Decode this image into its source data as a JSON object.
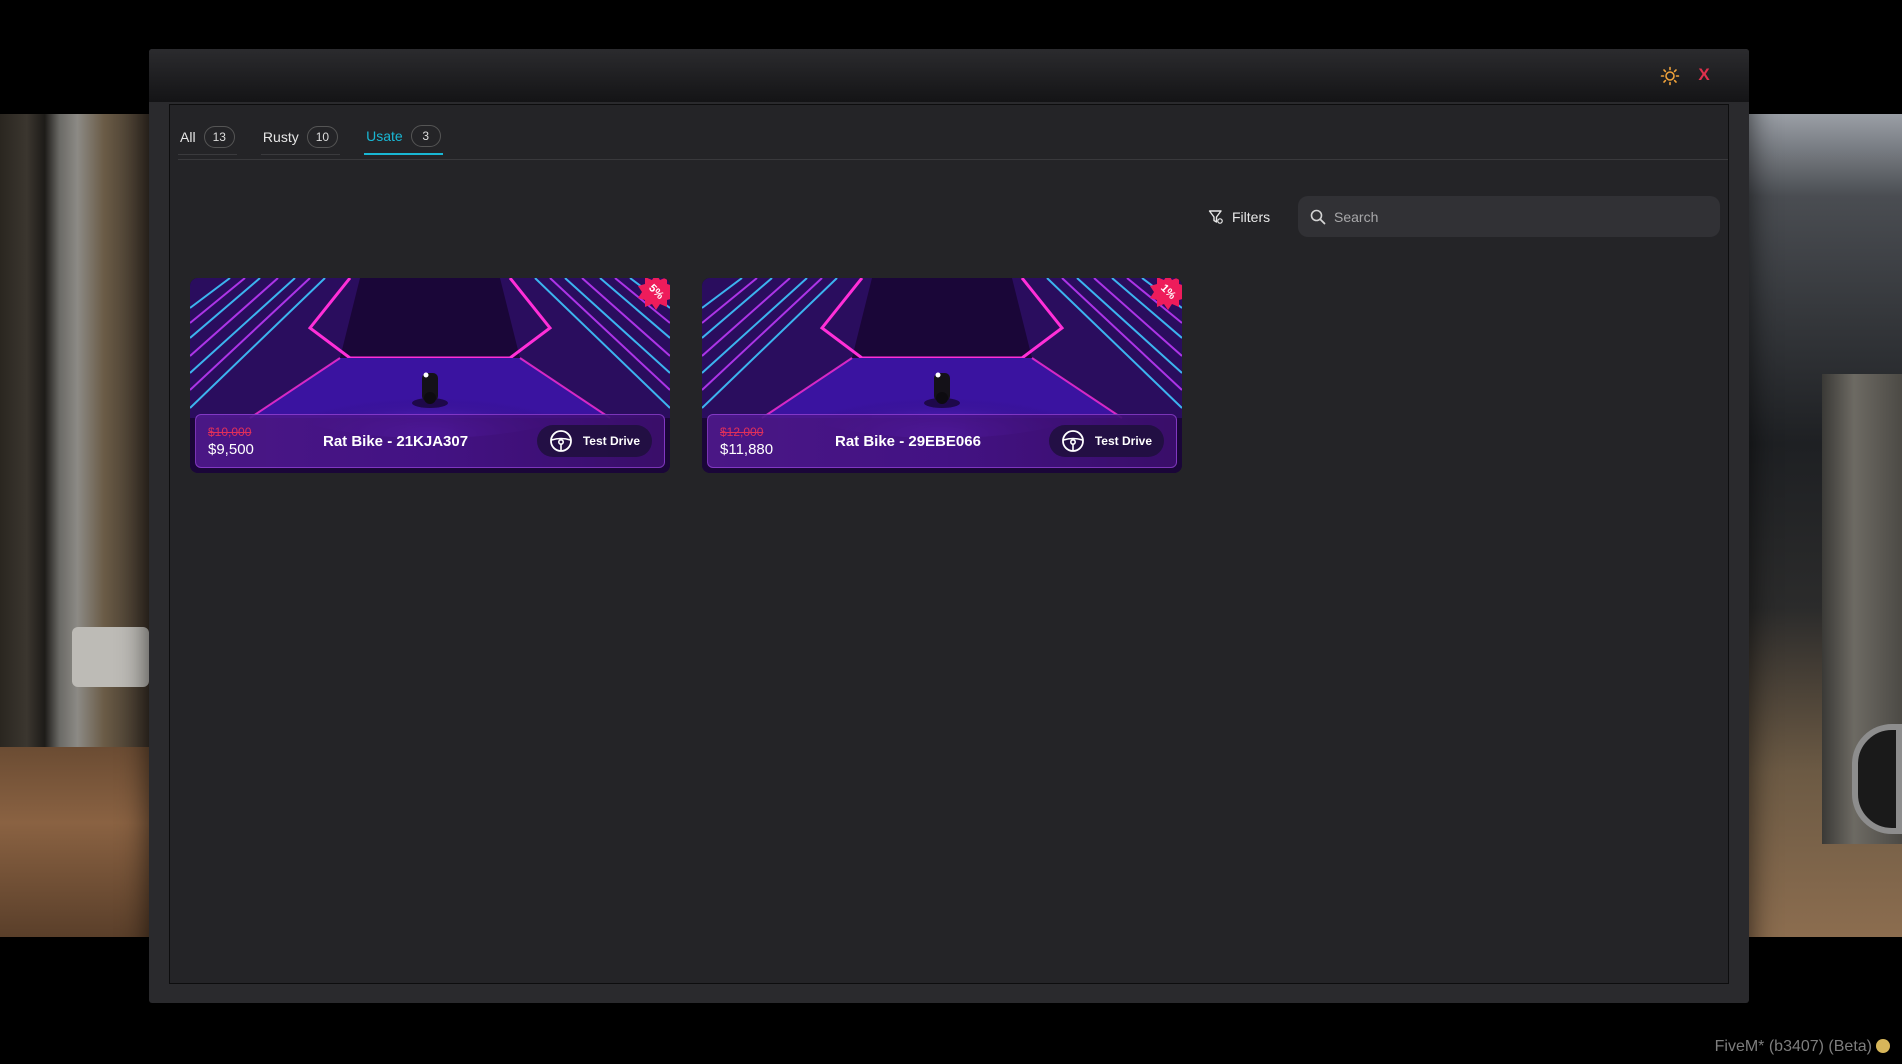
{
  "window": {
    "close_label": "X",
    "theme_icon": "sun-icon"
  },
  "tabs": [
    {
      "label": "All",
      "count": "13",
      "active": false
    },
    {
      "label": "Rusty",
      "count": "10",
      "active": false
    },
    {
      "label": "Usate",
      "count": "3",
      "active": true
    }
  ],
  "toolbar": {
    "filters_label": "Filters",
    "search_placeholder": "Search"
  },
  "vehicles": [
    {
      "name": "Rat Bike - 21KJA307",
      "old_price": "$10,000",
      "price": "$9,500",
      "discount": "5%",
      "action_label": "Test Drive"
    },
    {
      "name": "Rat Bike - 29EBE066",
      "old_price": "$12,000",
      "price": "$11,880",
      "discount": "1%",
      "action_label": "Test Drive"
    }
  ],
  "overlay": {
    "client_text": "FiveM* (b3407) (Beta)"
  },
  "colors": {
    "accent": "#19b7d4",
    "close": "#e0304d",
    "old_price": "#e0305a",
    "badge": "#ee1c5b",
    "theme_icon": "#f0a23a"
  }
}
